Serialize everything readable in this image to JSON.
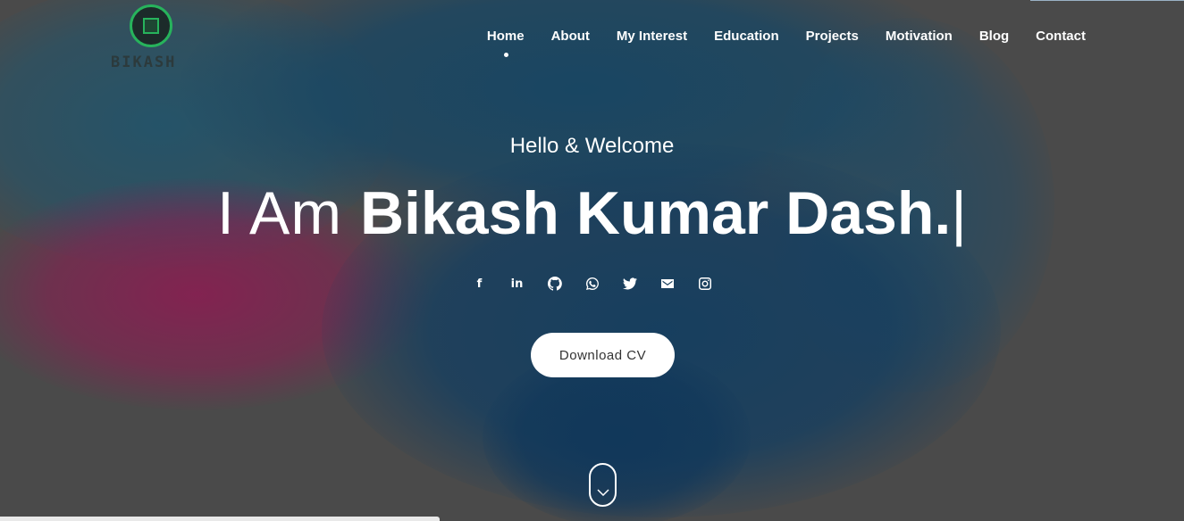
{
  "logo": {
    "text": "BIKASH",
    "accent_color": "#27b35c"
  },
  "nav": {
    "items": [
      {
        "label": "Home",
        "active": true
      },
      {
        "label": "About"
      },
      {
        "label": "My Interest"
      },
      {
        "label": "Education"
      },
      {
        "label": "Projects"
      },
      {
        "label": "Motivation"
      },
      {
        "label": "Blog"
      },
      {
        "label": "Contact"
      }
    ]
  },
  "hero": {
    "greeting": "Hello & Welcome",
    "intro": "I Am ",
    "name": "Bikash Kumar Dash.",
    "cursor": "|"
  },
  "socials": [
    {
      "icon": "facebook-icon",
      "glyph": "f"
    },
    {
      "icon": "linkedin-icon",
      "glyph": "in"
    },
    {
      "icon": "github-icon"
    },
    {
      "icon": "whatsapp-icon"
    },
    {
      "icon": "twitter-icon"
    },
    {
      "icon": "mail-icon"
    },
    {
      "icon": "instagram-icon"
    }
  ],
  "cta": {
    "label": "Download CV"
  },
  "scroll": {
    "icon": "chevron-down-icon"
  }
}
